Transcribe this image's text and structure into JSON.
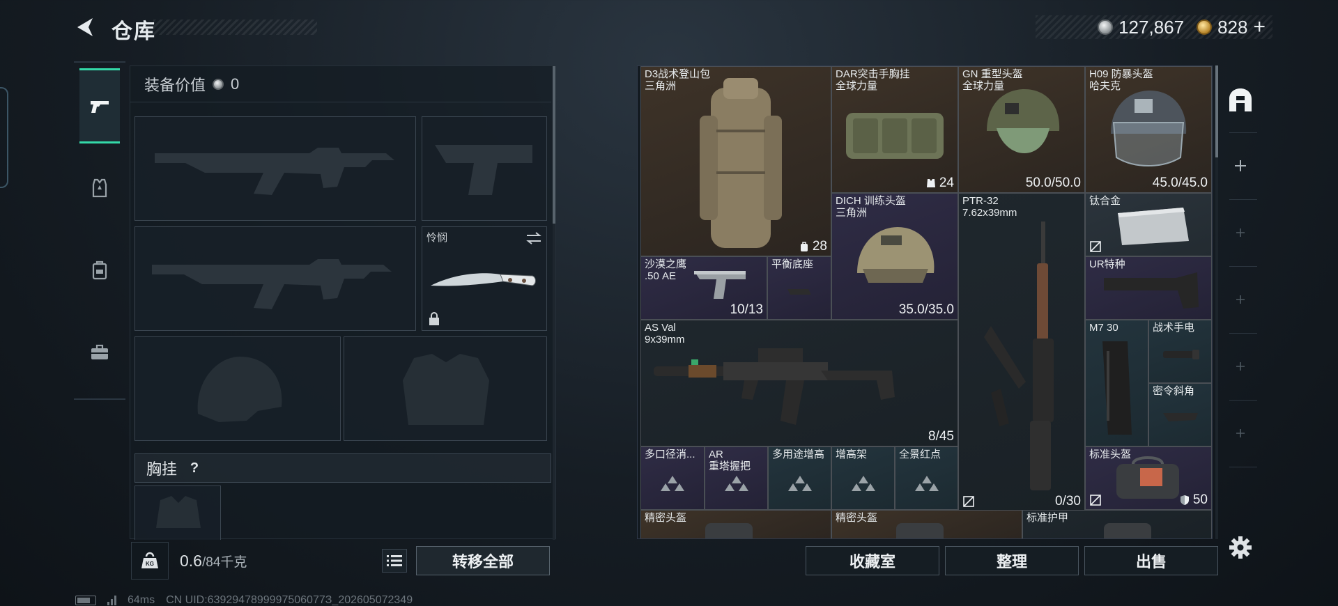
{
  "header": {
    "title": "仓库"
  },
  "currency": {
    "silver": "127,867",
    "gold": "828",
    "plus": "+"
  },
  "loadout": {
    "equip_value_label": "装备价值",
    "equip_value": "0",
    "knife_slot_label": "怜悯",
    "chest_label": "胸挂",
    "chest_help": "?",
    "weight_current": "0.6",
    "weight_max": "/84千克",
    "transfer_all": "转移全部"
  },
  "storage": {
    "items": [
      {
        "name": "D3战术登山包\n三角洲",
        "count": "28",
        "count_icon": "backpack-icon"
      },
      {
        "name": "DAR突击手胸挂\n全球力量",
        "count": "24",
        "count_icon": "vest-icon"
      },
      {
        "name": "GN 重型头盔\n全球力量",
        "count": "50.0/50.0"
      },
      {
        "name": "H09 防暴头盔\n哈夫克",
        "count": "45.0/45.0"
      },
      {
        "name": "DICH 训练头盔\n三角洲",
        "count": "35.0/35.0"
      },
      {
        "name": "PTR-32\n7.62x39mm",
        "count": "0/30"
      },
      {
        "name": "钛合金",
        "count": ""
      },
      {
        "name": "沙漠之鹰\n.50 AE",
        "count": "10/13"
      },
      {
        "name": "平衡底座",
        "count": ""
      },
      {
        "name": "UR特种",
        "count": ""
      },
      {
        "name": "AS Val\n9x39mm",
        "count": "8/45"
      },
      {
        "name": "M7 30",
        "count": ""
      },
      {
        "name": "战术手电",
        "count": ""
      },
      {
        "name": "密令斜角",
        "count": ""
      },
      {
        "name": "多口径消...",
        "count": ""
      },
      {
        "name": "AR\n重塔握把",
        "count": ""
      },
      {
        "name": "多用途增高",
        "count": ""
      },
      {
        "name": "增高架",
        "count": ""
      },
      {
        "name": "全景红点",
        "count": ""
      },
      {
        "name": "标准头盔",
        "count": "50"
      },
      {
        "name": "精密头盔",
        "count": ""
      },
      {
        "name": "精密头盔",
        "count": ""
      },
      {
        "name": "标准护甲",
        "count": ""
      }
    ]
  },
  "actions": {
    "collection": "收藏室",
    "organize": "整理",
    "sell": "出售"
  },
  "status": {
    "ping": "64ms",
    "uid": "CN UID:6392947899997506077З_202605072349"
  },
  "colors": {
    "accent": "#34d9a8",
    "slot_brown": "#3e3328",
    "slot_violet": "#2f2c45",
    "slot_teal": "#23343d"
  }
}
